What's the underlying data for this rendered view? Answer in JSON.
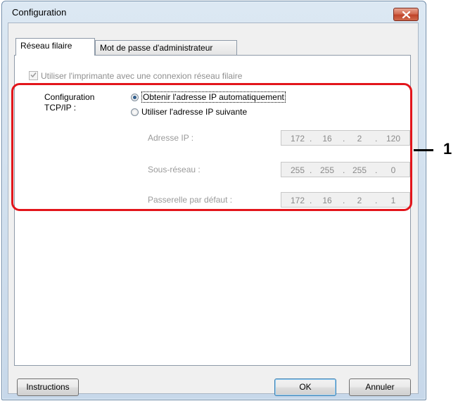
{
  "window": {
    "title": "Configuration"
  },
  "tabs": [
    {
      "label": "Réseau filaire",
      "active": true
    },
    {
      "label": "Mot de passe d'administrateur",
      "active": false
    }
  ],
  "wired": {
    "use_wired_label": "Utiliser l'imprimante avec une connexion réseau filaire",
    "use_wired_checked": true,
    "use_wired_enabled": false
  },
  "tcpip": {
    "group_label_line1": "Configuration",
    "group_label_line2": "TCP/IP :",
    "auto_label": "Obtenir l'adresse IP automatiquement",
    "manual_label": "Utiliser l'adresse IP suivante",
    "selected": "auto"
  },
  "fields": {
    "ip": {
      "label": "Adresse IP :",
      "octets": [
        "172",
        "16",
        "2",
        "120"
      ]
    },
    "subnet": {
      "label": "Sous-réseau :",
      "octets": [
        "255",
        "255",
        "255",
        "0"
      ]
    },
    "gateway": {
      "label": "Passerelle par défaut :",
      "octets": [
        "172",
        "16",
        "2",
        "1"
      ]
    }
  },
  "callout": {
    "number": "1",
    "color": "#e3151b"
  },
  "buttons": {
    "instructions": "Instructions",
    "ok": "OK",
    "cancel": "Annuler"
  },
  "icons": {
    "close": "close-icon",
    "check": "checkmark-icon"
  }
}
